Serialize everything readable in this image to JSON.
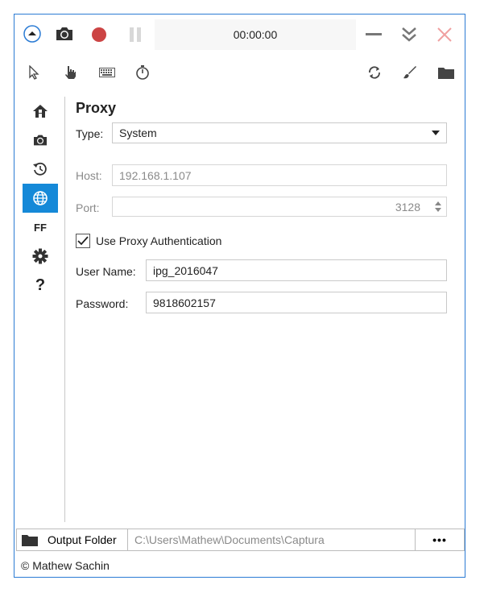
{
  "titlebar": {
    "timer": "00:00:00",
    "icons": [
      "collapse-up-icon",
      "camera-icon",
      "record-icon",
      "pause-icon",
      "minimize-icon",
      "double-chevron-down-icon",
      "close-icon"
    ],
    "colors": {
      "record": "#cc4444",
      "close": "#f0a0a0",
      "pause": "#d8d8d8",
      "active_blue": "#1589d8",
      "border_blue": "#2b7bd4"
    }
  },
  "toolbar": {
    "icons": [
      "cursor-icon",
      "click-hand-icon",
      "keyboard-icon",
      "stopwatch-icon",
      "refresh-icon",
      "brush-icon",
      "folder-icon"
    ]
  },
  "sidebar": {
    "items": [
      {
        "name": "home-icon"
      },
      {
        "name": "camera-icon"
      },
      {
        "name": "history-icon"
      },
      {
        "name": "globe-icon",
        "active": true
      },
      {
        "name": "ff-label",
        "text": "FF"
      },
      {
        "name": "gear-icon"
      },
      {
        "name": "help-icon",
        "text": "?"
      }
    ]
  },
  "proxy": {
    "title": "Proxy",
    "type_label": "Type:",
    "type_value": "System",
    "host_label": "Host:",
    "host_value": "192.168.1.107",
    "port_label": "Port:",
    "port_value": "3128",
    "use_auth_label": "Use Proxy Authentication",
    "use_auth_checked": true,
    "username_label": "User Name:",
    "username_value": "ipg_2016047",
    "password_label": "Password:",
    "password_value": "9818602157"
  },
  "bottom": {
    "output_folder_label": "Output Folder",
    "output_path": "C:\\Users\\Mathew\\Documents\\Captura",
    "more_label": "•••"
  },
  "footer": {
    "copyright": "© Mathew Sachin"
  }
}
